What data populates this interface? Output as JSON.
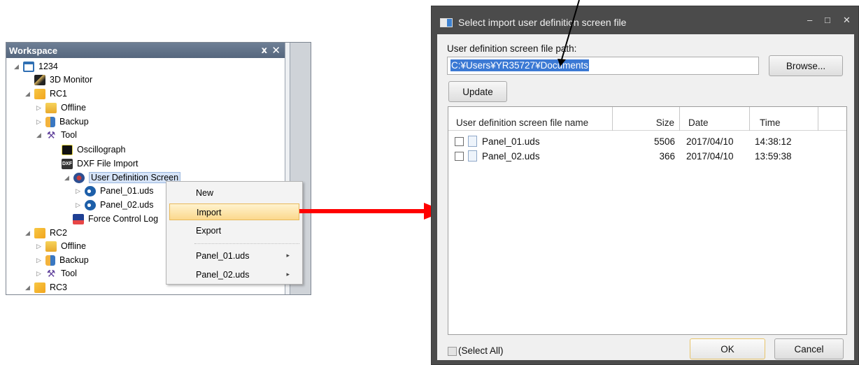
{
  "workspace": {
    "title": "Workspace",
    "pin_glyph": "ⅹ",
    "close_glyph": "✕",
    "tree": [
      {
        "label": "1234",
        "icon": "computer-icon"
      },
      {
        "label": "3D Monitor",
        "icon": "3d-monitor-icon"
      },
      {
        "label": "RC1",
        "icon": "controller-icon"
      },
      {
        "label": "Offline",
        "icon": "folder-icon"
      },
      {
        "label": "Backup",
        "icon": "backup-icon"
      },
      {
        "label": "Tool",
        "icon": "tool-icon"
      },
      {
        "label": "Oscillograph",
        "icon": "oscillograph-icon"
      },
      {
        "label": "DXF File Import",
        "icon": "dxf-icon"
      },
      {
        "label": "User Definition Screen",
        "icon": "user-definition-icon"
      },
      {
        "label": "Panel_01.uds",
        "icon": "panel-icon"
      },
      {
        "label": "Panel_02.uds",
        "icon": "panel-icon"
      },
      {
        "label": "Force Control Log",
        "icon": "force-log-icon"
      },
      {
        "label": "RC2",
        "icon": "controller-icon"
      },
      {
        "label": "Offline",
        "icon": "folder-icon"
      },
      {
        "label": "Backup",
        "icon": "backup-icon"
      },
      {
        "label": "Tool",
        "icon": "tool-icon"
      },
      {
        "label": "RC3",
        "icon": "controller-icon"
      }
    ],
    "dxf_icon_text": "DXF"
  },
  "context_menu": {
    "items": [
      "New",
      "Import",
      "Export",
      "Panel_01.uds",
      "Panel_02.uds"
    ],
    "highlighted": "Import",
    "submenu_glyph": "▸"
  },
  "dialog": {
    "title": "Select import user definition screen file",
    "minimize_glyph": "–",
    "maximize_glyph": "□",
    "close_glyph": "✕",
    "path_label": "User definition screen file path:",
    "path_value": "C:¥Users¥YR35727¥Documents",
    "browse_label": "Browse...",
    "update_label": "Update",
    "columns": [
      "User definition screen file name",
      "Size",
      "Date",
      "Time"
    ],
    "files": [
      {
        "name": "Panel_01.uds",
        "size": "5506",
        "date": "2017/04/10",
        "time": "14:38:12"
      },
      {
        "name": "Panel_02.uds",
        "size": "366",
        "date": "2017/04/10",
        "time": "13:59:38"
      }
    ],
    "select_all_label": "(Select All)",
    "ok_label": "OK",
    "cancel_label": "Cancel"
  },
  "colors": {
    "highlight": "#fbd88c",
    "arrow": "#ff0000",
    "dialog_frame": "#4b4b4b",
    "selection_blue": "#3b79d4"
  }
}
